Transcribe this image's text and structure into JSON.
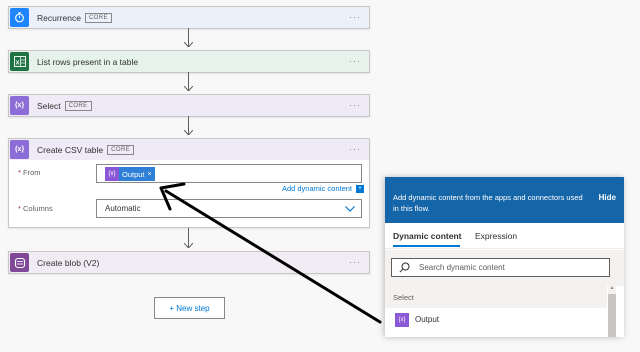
{
  "flow": {
    "steps": [
      {
        "title": "Recurrence",
        "badge": "CORE",
        "more": "···"
      },
      {
        "title": "List rows present in a table",
        "more": "···"
      },
      {
        "title": "Select",
        "badge": "CORE",
        "more": "···"
      },
      {
        "title": "Create CSV table",
        "badge": "CORE",
        "more": "···"
      },
      {
        "title": "Create blob (V2)",
        "more": "···"
      }
    ],
    "csv": {
      "from_label": "From",
      "required_mark": "*",
      "token_icon": "{x}",
      "token_label": "Output",
      "token_remove": "×",
      "add_dynamic": "Add dynamic content",
      "add_dynamic_icon": "+",
      "columns_label": "Columns",
      "columns_value": "Automatic"
    },
    "new_step_label": "+ New step"
  },
  "icons": {
    "recurrence": "stopwatch-icon",
    "excel": "excel-icon",
    "data_operation": "curly-braces-icon",
    "blob": "blob-storage-icon"
  },
  "colors": {
    "recurrence": "#1f85ff",
    "excel": "#217346",
    "data_operation": "#8c6cd6",
    "blob": "#804998",
    "accent": "#0078d4",
    "panel_header": "#1565a9"
  },
  "panel": {
    "header_text": "Add dynamic content from the apps and connectors used in this flow.",
    "hide_label": "Hide",
    "tabs": [
      "Dynamic content",
      "Expression"
    ],
    "active_tab": "Dynamic content",
    "search_placeholder": "Search dynamic content",
    "section": "Select",
    "items": [
      {
        "icon": "{x}",
        "label": "Output"
      }
    ]
  }
}
